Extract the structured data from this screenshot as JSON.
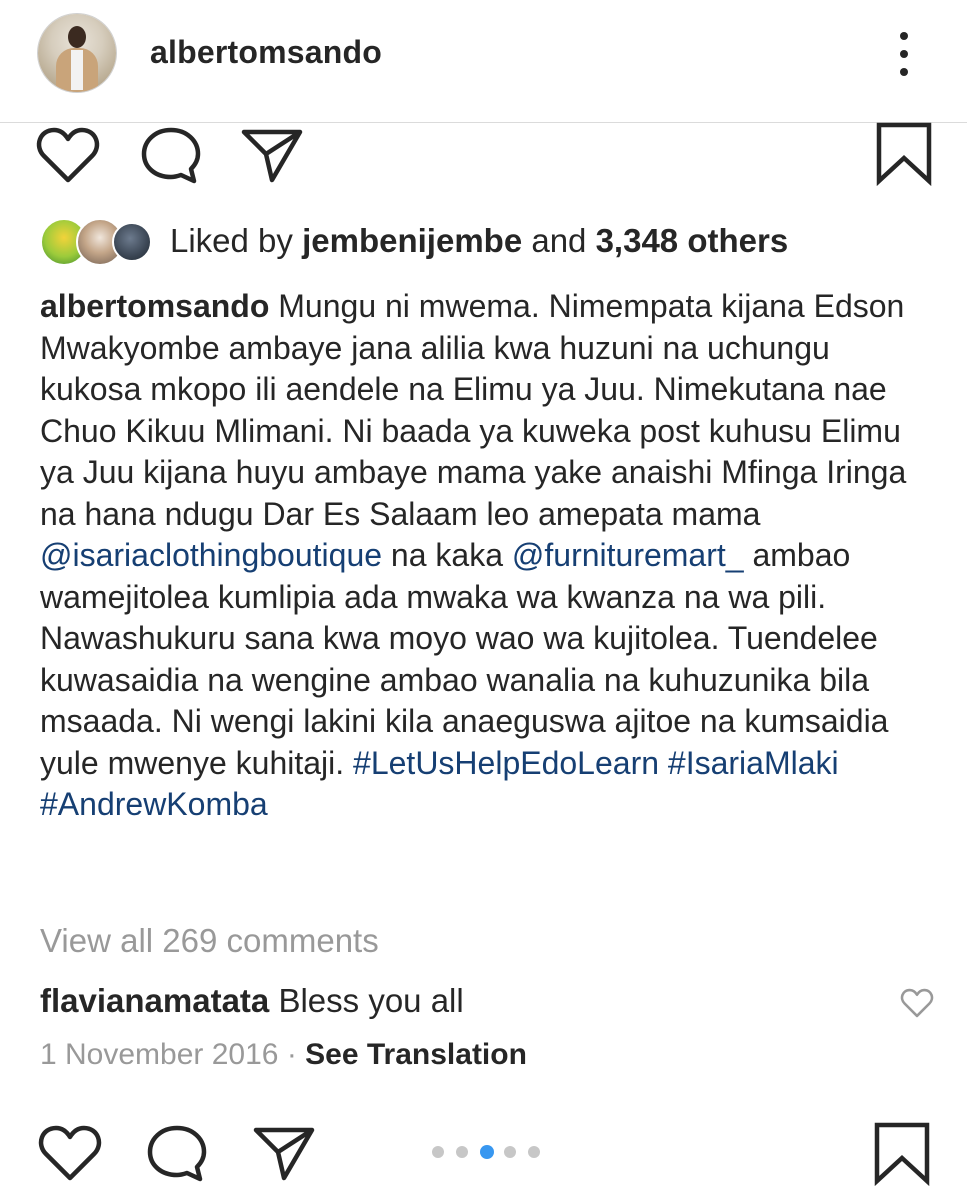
{
  "post": {
    "username": "albertomsando",
    "likes": {
      "prefix": "Liked by",
      "first_liker": "jembenijembe",
      "joiner": "and",
      "others": "3,348 others"
    },
    "caption": {
      "author": "albertomsando",
      "text_1": " Mungu ni mwema. Nimempata kijana Edson Mwakyombe ambaye jana alilia kwa huzuni na uchungu kukosa mkopo ili aendele na Elimu ya Juu. Nimekutana nae Chuo Kikuu Mlimani. Ni baada ya kuweka post kuhusu Elimu ya Juu kijana huyu ambaye mama yake anaishi Mfinga Iringa na hana ndugu Dar Es Salaam leo amepata mama ",
      "mention_1": "@isariaclothingboutique",
      "text_2": " na kaka ",
      "mention_2": "@furnituremart_",
      "text_3": " ambao wamejitolea kumlipia ada mwaka wa kwanza na wa pili. Nawashukuru sana kwa moyo wao wa kujitolea. Tuendelee kuwasaidia na wengine ambao wanalia na kuhuzunika bila msaada. Ni wengi lakini kila anaeguswa ajitoe na kumsaidia yule mwenye kuhitaji. ",
      "hashtag_1": "#LetUsHelpEdoLearn",
      "text_4": " ",
      "hashtag_2": "#IsariaMlaki",
      "text_5": " ",
      "hashtag_3": "#AndrewKomba"
    },
    "view_all_comments": "View all 269 comments",
    "comment": {
      "user": "flavianamatata",
      "text": " Bless you all"
    },
    "date": "1 November 2016",
    "separator": "·",
    "see_translation": "See Translation",
    "carousel": {
      "count": 5,
      "active_index": 2
    }
  },
  "colors": {
    "text": "#262626",
    "link": "#163f73",
    "muted": "#999999",
    "active_dot": "#3897f0",
    "inactive_dot": "#c7c7c7"
  },
  "icons": {
    "more": "more-vertical-icon",
    "like": "heart-outline-icon",
    "comment": "comment-bubble-icon",
    "share": "paper-plane-icon",
    "save": "bookmark-icon"
  }
}
